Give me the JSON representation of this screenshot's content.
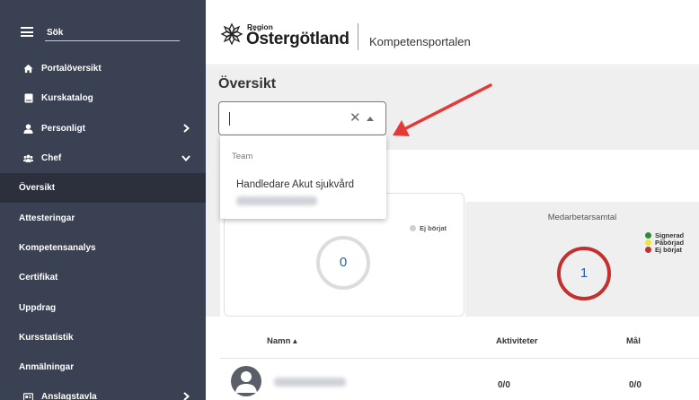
{
  "sidebar": {
    "search_placeholder": "Sök",
    "items": [
      {
        "label": "Portalöversikt",
        "icon": "home-icon"
      },
      {
        "label": "Kurskatalog",
        "icon": "book-icon"
      },
      {
        "label": "Personligt",
        "icon": "user-icon",
        "chevron": "right"
      },
      {
        "label": "Chef",
        "icon": "users-icon",
        "chevron": "down"
      },
      {
        "label": "Översikt",
        "active": true
      },
      {
        "label": "Attesteringar"
      },
      {
        "label": "Kompetensanalys"
      },
      {
        "label": "Certifikat"
      },
      {
        "label": "Uppdrag"
      },
      {
        "label": "Kursstatistik"
      },
      {
        "label": "Anmälningar"
      },
      {
        "label": "Anslagstavla",
        "icon": "board-icon",
        "chevron": "right"
      }
    ],
    "colors": {
      "background": "#3a4152",
      "active": "#2b303c"
    }
  },
  "header": {
    "logo_region": "Region",
    "logo_name": "Östergötland",
    "portal_title": "Kompetensportalen"
  },
  "main": {
    "page_title": "Översikt",
    "team_select": {
      "value": "",
      "clear_icon": "close-icon",
      "arrow_icon": "caret-up-icon"
    },
    "dropdown": {
      "group_label": "Team",
      "option": "Handledare Akut sjukvård"
    },
    "card_left": {
      "legend": [
        "Ej börjat"
      ],
      "gauge_value": "0"
    },
    "card_right": {
      "title": "Medarbetarsamtal",
      "gauge_value": "1",
      "legend": [
        {
          "label": "Signerad",
          "color": "#2e8b2e"
        },
        {
          "label": "Påbörjad",
          "color": "#e8e83a"
        },
        {
          "label": "Ej börjat",
          "color": "#c0312f"
        }
      ]
    },
    "table": {
      "columns": {
        "name": "Namn ▴",
        "activities": "Aktiviteter",
        "goals": "Mål"
      },
      "rows": [
        {
          "activities": "0/0",
          "goals": "0/0"
        }
      ]
    },
    "accent_color": "#e53935"
  }
}
